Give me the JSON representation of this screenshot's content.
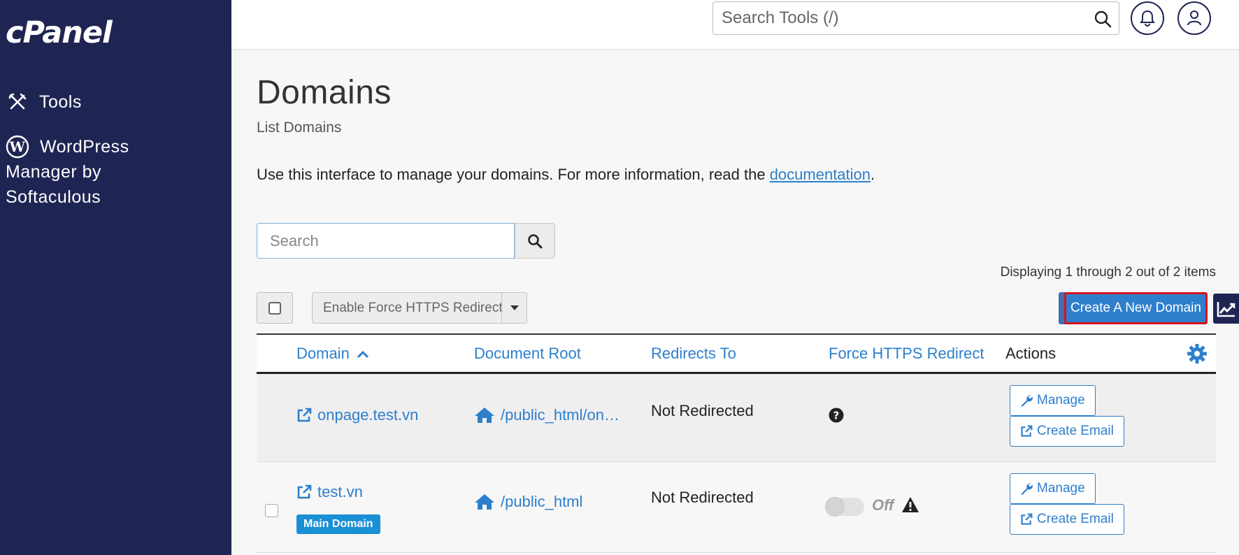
{
  "app": {
    "logo_text": "cPanel"
  },
  "sidebar": {
    "items": [
      {
        "label": "Tools",
        "icon": "tools-icon"
      },
      {
        "label": "WordPress Manager by Softaculous",
        "icon": "wordpress-icon"
      }
    ]
  },
  "header": {
    "search_placeholder": "Search Tools (/)",
    "icons": [
      "search-icon",
      "bell-icon",
      "user-icon"
    ]
  },
  "page": {
    "title": "Domains",
    "subtitle": "List Domains",
    "intro_text": "Use this interface to manage your domains. For more information, read the ",
    "intro_link": "documentation",
    "intro_end": "."
  },
  "search": {
    "placeholder": "Search"
  },
  "displaying": "Displaying 1 through 2 out of 2 items",
  "toolbar": {
    "force_https_label": "Enable Force HTTPS Redirect",
    "create_label": "Create A New Domain"
  },
  "table": {
    "columns": {
      "domain": "Domain",
      "document_root": "Document Root",
      "redirects_to": "Redirects To",
      "force_https": "Force HTTPS Redirect",
      "actions": "Actions"
    },
    "rows": [
      {
        "domain": "onpage.test.vn",
        "document_root": "/public_html/on…",
        "redirects_to": "Not Redirected",
        "force_https_state": "unknown",
        "manage_label": "Manage",
        "create_email_label": "Create Email"
      },
      {
        "domain": "test.vn",
        "badge": "Main Domain",
        "document_root": "/public_html",
        "redirects_to": "Not Redirected",
        "force_https_state": "Off",
        "manage_label": "Manage",
        "create_email_label": "Create Email"
      }
    ]
  },
  "colors": {
    "sidebar_bg": "#1f2553",
    "accent": "#2d7fcc",
    "highlight_border": "#d9121f",
    "badge": "#1a8fd5"
  }
}
